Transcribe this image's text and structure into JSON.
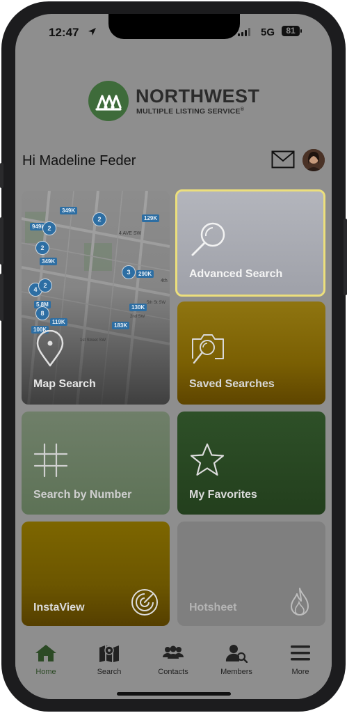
{
  "status_bar": {
    "time": "12:47",
    "network": "5G",
    "battery": "81"
  },
  "logo": {
    "title": "NORTHWEST",
    "subtitle": "MULTIPLE LISTING SERVICE",
    "trademark": "®"
  },
  "header": {
    "greeting": "Hi Madeline Feder"
  },
  "map_tile": {
    "label": "Map Search",
    "price_pins": [
      "349K",
      "949K",
      "129K",
      "349K",
      "290K",
      "5.8M",
      "130K",
      "119K",
      "183K",
      "100K"
    ],
    "clusters": [
      "2",
      "2",
      "2",
      "3",
      "4",
      "2",
      "8"
    ],
    "street_labels": [
      "4 AVE SW",
      "4th",
      "5th St SW",
      "2nd SW",
      "1st Street SW"
    ]
  },
  "tiles": [
    {
      "label": "Advanced Search",
      "icon": "magnifier-icon",
      "color": "#a9abb3",
      "highlight": "#ecdf7c"
    },
    {
      "label": "Saved Searches",
      "icon": "saved-search-icon",
      "color": "#8a6e06"
    },
    {
      "label": "Search by Number",
      "icon": "hash-icon",
      "color": "#607858"
    },
    {
      "label": "My Favorites",
      "icon": "star-icon",
      "color": "#2a4a24"
    },
    {
      "label": "InstaView",
      "icon": "radar-icon",
      "color": "#7c6400"
    },
    {
      "label": "Hotsheet",
      "icon": "flame-icon",
      "color": "#808080"
    }
  ],
  "tabbar": {
    "items": [
      {
        "label": "Home",
        "icon": "home-icon"
      },
      {
        "label": "Search",
        "icon": "map-icon"
      },
      {
        "label": "Contacts",
        "icon": "contacts-icon"
      },
      {
        "label": "Members",
        "icon": "members-icon"
      },
      {
        "label": "More",
        "icon": "menu-icon"
      }
    ],
    "active_color": "#2c4a25"
  }
}
